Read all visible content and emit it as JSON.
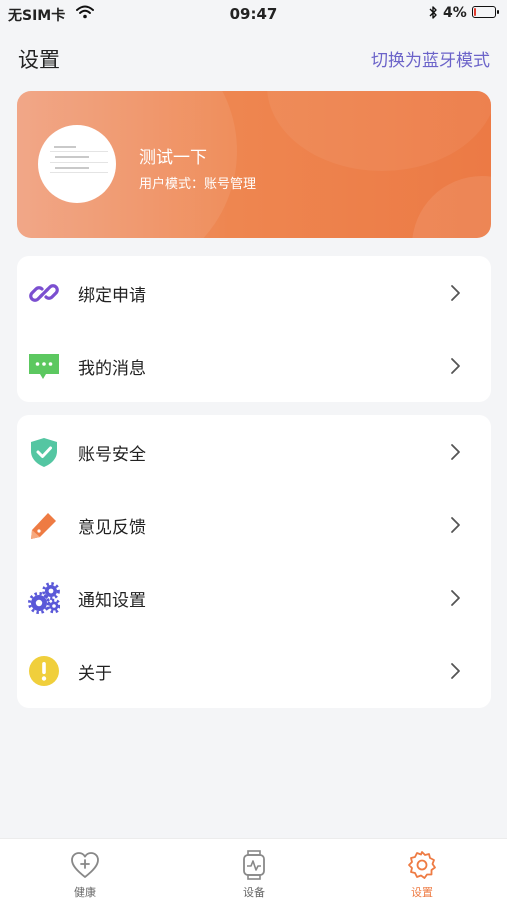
{
  "status_bar": {
    "carrier": "无SIM卡",
    "time": "09:47",
    "battery_percent": "4%",
    "battery_level": 0.04
  },
  "header": {
    "title": "设置",
    "switch_mode_label": "切换为蓝牙模式"
  },
  "profile": {
    "name": "测试一下",
    "mode_label": "用户模式：",
    "mode_value": "账号管理"
  },
  "menu_group_1": [
    {
      "label": "绑定申请",
      "icon": "link-icon"
    },
    {
      "label": "我的消息",
      "icon": "message-icon"
    }
  ],
  "menu_group_2": [
    {
      "label": "账号安全",
      "icon": "shield-check-icon"
    },
    {
      "label": "意见反馈",
      "icon": "pencil-icon"
    },
    {
      "label": "通知设置",
      "icon": "gears-icon"
    },
    {
      "label": "关于",
      "icon": "exclamation-icon"
    }
  ],
  "tabbar": {
    "tabs": [
      {
        "label": "健康",
        "icon": "heart-plus-icon",
        "active": false
      },
      {
        "label": "设备",
        "icon": "watch-icon",
        "active": false
      },
      {
        "label": "设置",
        "icon": "gear-icon",
        "active": true
      }
    ]
  },
  "colors": {
    "accent": "#ee7b43",
    "switch_link": "#6b63c9",
    "link_icon": "#7b4fd0",
    "message_icon": "#5cc860",
    "shield_icon": "#54c6a2",
    "pencil_icon": "#ee7b43",
    "gears_icon": "#5a58d8",
    "about_icon": "#f0cf3c"
  }
}
